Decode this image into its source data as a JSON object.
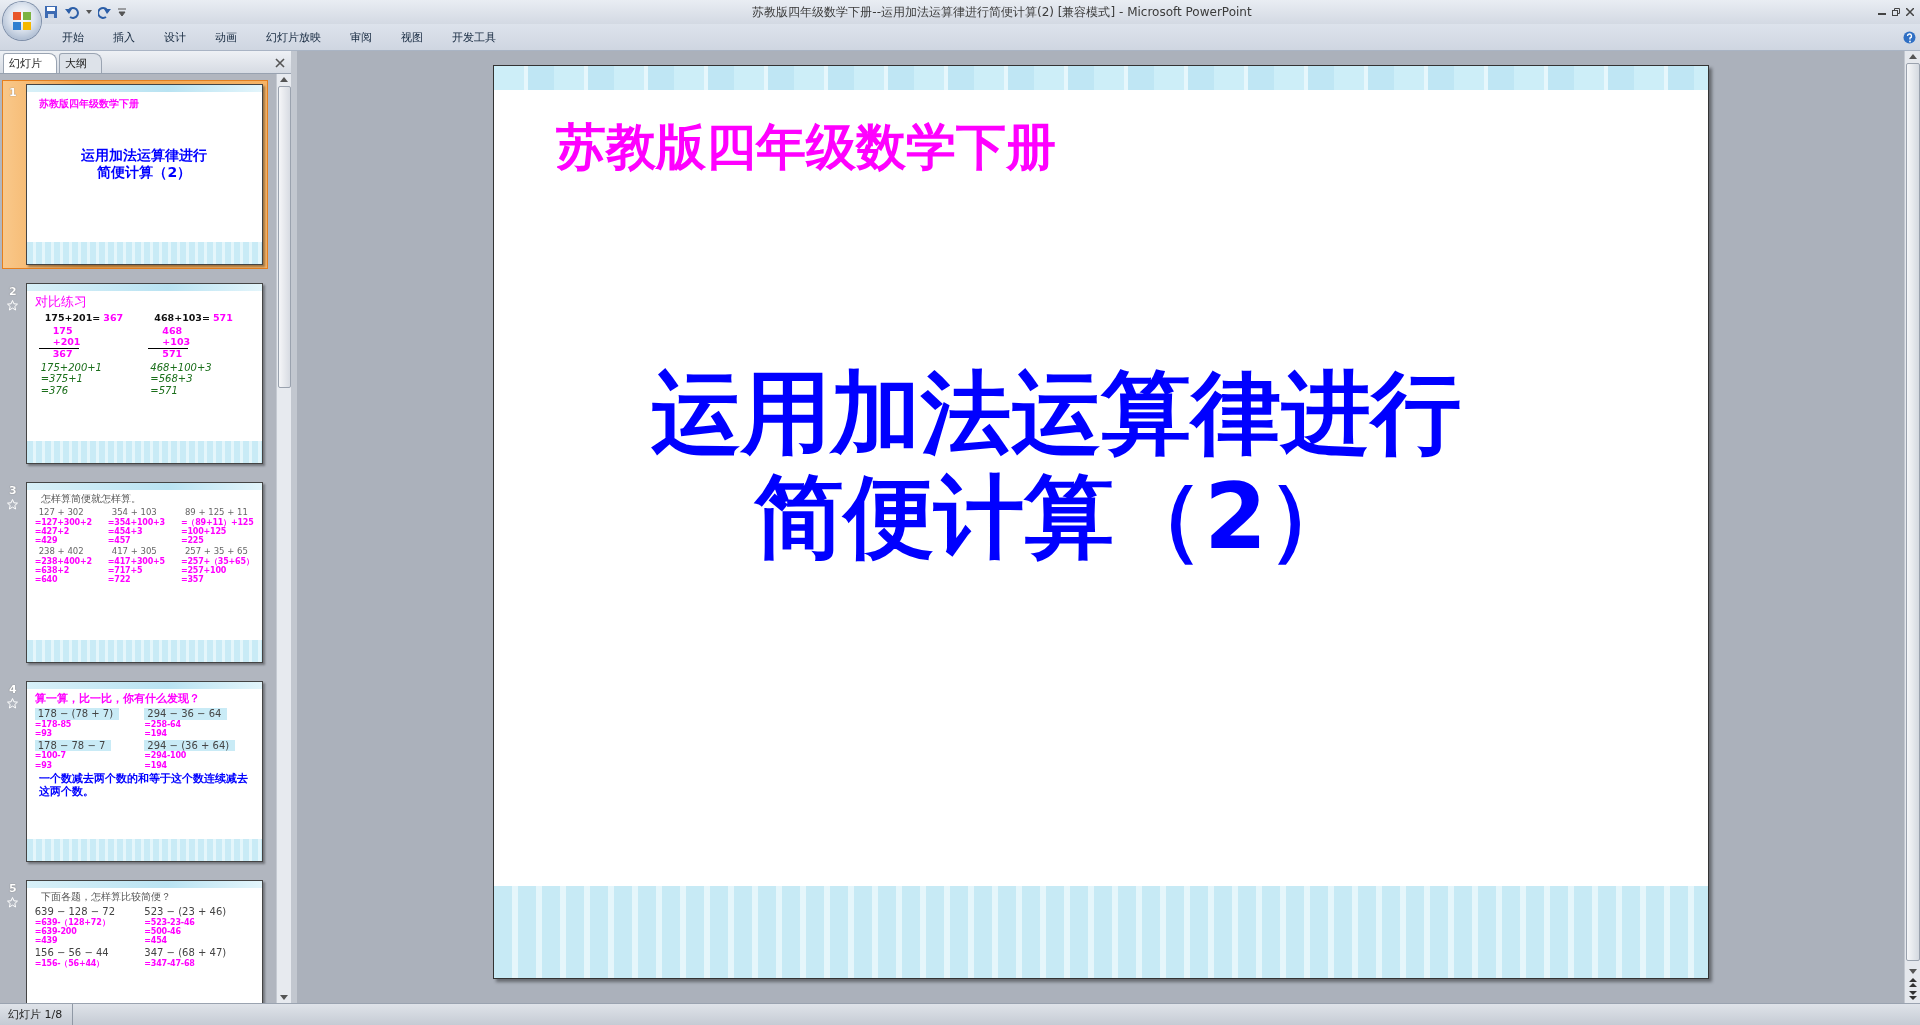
{
  "window": {
    "title": "苏教版四年级数学下册--运用加法运算律进行简便计算(2) [兼容模式] - Microsoft PowerPoint"
  },
  "ribbon_tabs": [
    {
      "label": "开始",
      "selected": false
    },
    {
      "label": "插入",
      "selected": false
    },
    {
      "label": "设计",
      "selected": false
    },
    {
      "label": "动画",
      "selected": false
    },
    {
      "label": "幻灯片放映",
      "selected": false
    },
    {
      "label": "审阅",
      "selected": false
    },
    {
      "label": "视图",
      "selected": false
    },
    {
      "label": "开发工具",
      "selected": false
    }
  ],
  "pane_tabs": [
    {
      "label": "幻灯片",
      "selected": true
    },
    {
      "label": "大纲",
      "selected": false
    }
  ],
  "slides": [
    {
      "number": "1",
      "selected": true,
      "animated": false,
      "kind": "title",
      "subtitle": "苏教版四年级数学下册",
      "title_lines": [
        "运用加法运算律进行",
        "简便计算（2）"
      ]
    },
    {
      "number": "2",
      "selected": false,
      "animated": true,
      "kind": "practice",
      "heading": "对比练习",
      "rows": [
        {
          "kind": "equation",
          "cells": [
            {
              "expression": "175+201=",
              "answer": "367"
            },
            {
              "expression": "468+103=",
              "answer": "571"
            }
          ]
        },
        {
          "kind": "vertical",
          "cells": [
            {
              "steps": [
                "175",
                "+201",
                "367"
              ]
            },
            {
              "steps": [
                "468",
                "+103",
                "571"
              ]
            }
          ]
        },
        {
          "kind": "italic",
          "cells": [
            {
              "steps": [
                "175+200+1",
                "=375+1",
                "=376"
              ]
            },
            {
              "steps": [
                "468+100+3",
                "=568+3",
                "=571"
              ]
            }
          ]
        }
      ]
    },
    {
      "number": "3",
      "selected": false,
      "animated": true,
      "kind": "worked",
      "heading": "怎样算简便就怎样算。",
      "rows": [
        {
          "kind": "plain",
          "cells": [
            {
              "expression": "127 + 302",
              "steps": [
                "=127+300+2",
                "=427+2",
                "=429"
              ]
            },
            {
              "expression": "354 + 103",
              "steps": [
                "=354+100+3",
                "=454+3",
                "=457"
              ]
            },
            {
              "expression": "89 + 125 + 11",
              "steps": [
                "=（89+11）+125",
                "=100+125",
                "=225"
              ]
            }
          ]
        },
        {
          "kind": "plain",
          "cells": [
            {
              "expression": "238 + 402",
              "steps": [
                "=238+400+2",
                "=638+2",
                "=640"
              ]
            },
            {
              "expression": "417 + 305",
              "steps": [
                "=417+300+5",
                "=717+5",
                "=722"
              ]
            },
            {
              "expression": "257 + 35 + 65",
              "steps": [
                "=257+（35+65）",
                "=257+100",
                "=357"
              ]
            }
          ]
        }
      ]
    },
    {
      "number": "4",
      "selected": false,
      "animated": true,
      "kind": "discovery",
      "heading": "算一算，比一比，你有什么发现？",
      "rows": [
        {
          "kind": "boxed",
          "cells": [
            {
              "expression": "178 − (78 + 7)",
              "steps": [
                "=178-85",
                "=93"
              ]
            },
            {
              "expression": "294 − 36 − 64",
              "steps": [
                "=258-64",
                "=194"
              ]
            }
          ]
        },
        {
          "kind": "boxed",
          "cells": [
            {
              "expression": "178 − 78 − 7",
              "steps": [
                "=100-7",
                "=93"
              ]
            },
            {
              "expression": "294 − (36 + 64)",
              "steps": [
                "=294-100",
                "=194"
              ]
            }
          ]
        }
      ],
      "note": "一个数减去两个数的和等于这个数连续减去这两个数。"
    },
    {
      "number": "5",
      "selected": false,
      "animated": true,
      "kind": "worked",
      "heading": "下面各题，怎样算比较简便？",
      "rows": [
        {
          "kind": "large",
          "cells": [
            {
              "expression": "639 − 128 − 72",
              "steps": [
                "=639-（128+72）",
                "=639-200",
                "=439"
              ]
            },
            {
              "expression": "523 − (23 + 46)",
              "steps": [
                "=523-23-46",
                "=500-46",
                "=454"
              ]
            }
          ]
        },
        {
          "kind": "large",
          "cells": [
            {
              "expression": "156 − 56 − 44",
              "steps": [
                "=156-（56+44）"
              ]
            },
            {
              "expression": "347 − (68 + 47)",
              "steps": [
                "=347-47-68"
              ]
            }
          ]
        }
      ]
    }
  ],
  "main_slide": {
    "subtitle": "苏教版四年级数学下册",
    "title_lines": [
      "运用加法运算律进行",
      "简便计算（2）"
    ]
  },
  "status_bar": {
    "slide_position": "幻灯片 1/8"
  }
}
